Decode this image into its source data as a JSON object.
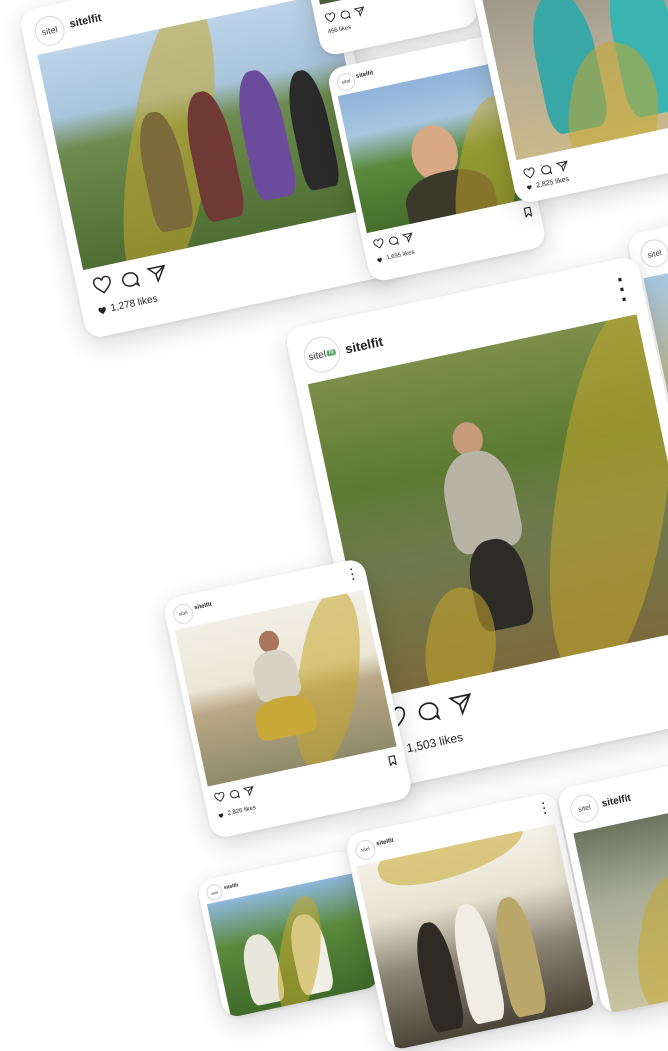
{
  "brand": {
    "account": "sitelfit",
    "avatar_text": "sitel",
    "avatar_badge": "fit"
  },
  "colors": {
    "brush": "#c4a82e",
    "card_bg": "#ffffff",
    "text": "#222222",
    "avatar_badge": "#5fa86b"
  },
  "posts": [
    {
      "id": "group-hike",
      "username": "sitelfit",
      "likes": "1,278 likes"
    },
    {
      "id": "top-mid",
      "username": "",
      "likes": "456 likes"
    },
    {
      "id": "sunglasses-selfie",
      "username": "sitelfit",
      "likes": "1,695 likes"
    },
    {
      "id": "tennis",
      "username": "",
      "likes": "2,825 likes"
    },
    {
      "id": "river-hiker",
      "username": "sitelfit",
      "likes": "1,503 likes"
    },
    {
      "id": "squat",
      "username": "sitelfit",
      "likes": "2,826 likes"
    },
    {
      "id": "cyclists",
      "username": "sitelfit",
      "likes": ""
    },
    {
      "id": "group-photo",
      "username": "sitelfit",
      "likes": ""
    },
    {
      "id": "right-bottom",
      "username": "sitelfit",
      "likes": ""
    },
    {
      "id": "right-mid",
      "username": "",
      "likes": ""
    }
  ],
  "icons": [
    "heart-icon",
    "comment-icon",
    "share-icon",
    "bookmark-icon",
    "more-options-icon"
  ]
}
